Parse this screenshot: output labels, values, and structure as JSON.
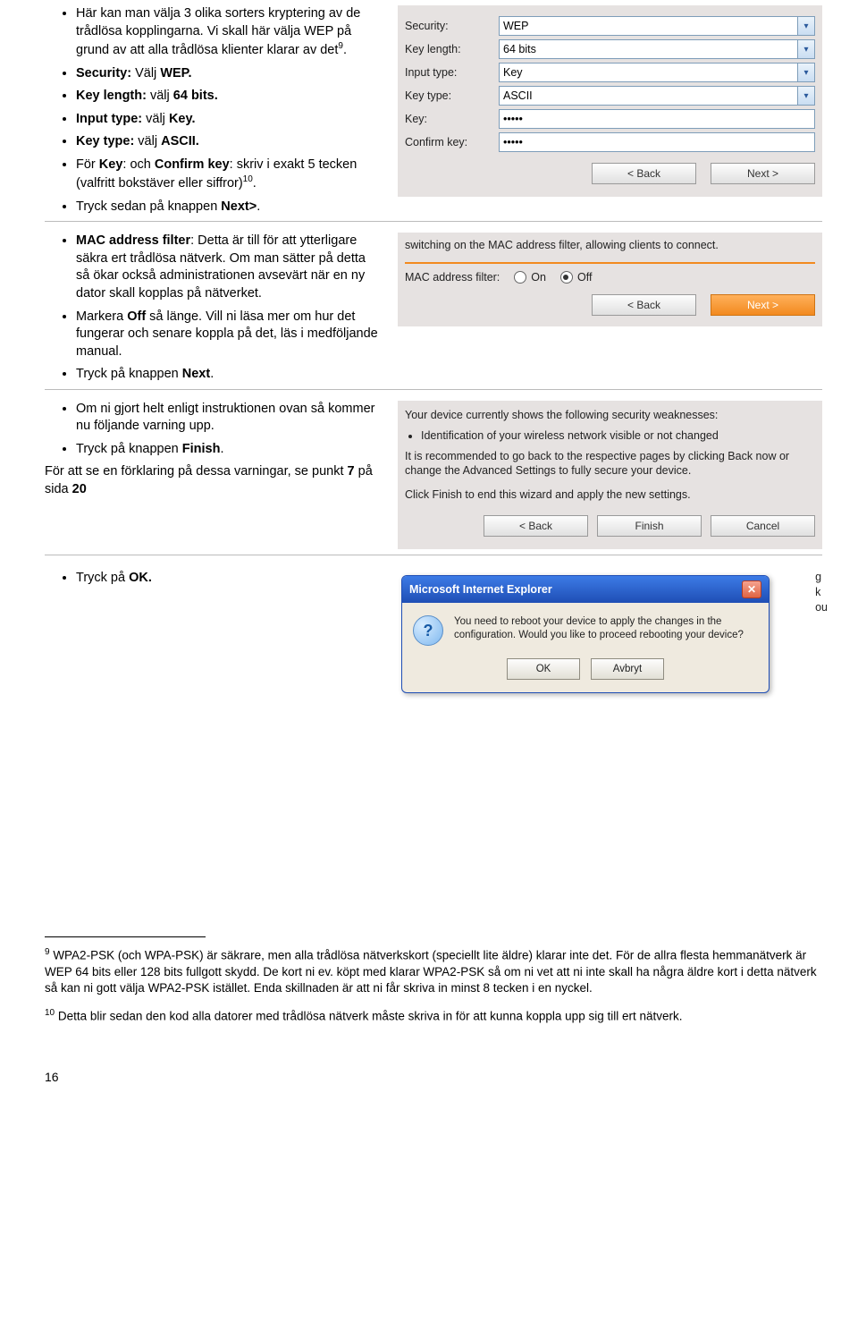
{
  "section1": {
    "bullets": [
      {
        "pre": "Här kan man välja 3 olika sorters kryptering av de trådlösa kopplingarna. Vi skall här välja WEP på grund av att alla trådlösa klienter klarar av det",
        "sup": "9",
        "post": "."
      },
      {
        "bold_parts": [
          "Security:",
          " Välj ",
          "WEP."
        ]
      },
      {
        "bold_parts": [
          "Key length:",
          " välj ",
          "64 bits."
        ]
      },
      {
        "bold_parts": [
          "Input type:",
          " välj ",
          "Key."
        ]
      },
      {
        "bold_parts": [
          "Key type:",
          " välj ",
          "ASCII."
        ]
      },
      {
        "text_a": "För ",
        "k": "Key",
        "text_b": ": och ",
        "ck": "Confirm key",
        "text_c": ": skriv i exakt 5 tecken (valfritt bokstäver eller siffror)",
        "sup": "10",
        "post": "."
      },
      {
        "text_a": "Tryck sedan på knappen ",
        "nb": "Next>",
        "post": "."
      }
    ],
    "form": {
      "security_label": "Security:",
      "security_value": "WEP",
      "keylen_label": "Key length:",
      "keylen_value": "64 bits",
      "input_label": "Input type:",
      "input_value": "Key",
      "keytype_label": "Key type:",
      "keytype_value": "ASCII",
      "key_label": "Key:",
      "key_value": "•••••",
      "confirm_label": "Confirm key:",
      "confirm_value": "•••••",
      "back": "< Back",
      "next": "Next >"
    }
  },
  "section2": {
    "bullets": [
      {
        "b": "MAC address filter",
        "text": ": Detta är till för att ytterligare säkra ert trådlösa nätverk. Om man sätter på detta så ökar också administrationen avsevärt när en ny dator skall kopplas på nätverket."
      },
      {
        "pre": "Markera ",
        "b": "Off",
        "text": " så länge. Vill ni läsa mer om hur det fungerar och senare koppla på det, läs i medföljande manual."
      },
      {
        "pre": "Tryck på knappen ",
        "b": "Next",
        "post": "."
      }
    ],
    "panel": {
      "line": "switching on the MAC address filter, allowing clients to connect.",
      "filter_label": "MAC address filter:",
      "on": "On",
      "off": "Off",
      "back": "< Back",
      "next": "Next >"
    }
  },
  "section3": {
    "bullets": [
      {
        "text": "Om ni gjort helt enligt instruktionen ovan så kommer nu följande varning upp."
      },
      {
        "pre": "Tryck på knappen ",
        "b": "Finish",
        "post": "."
      }
    ],
    "after_a": "För att se en förklaring på dessa varningar, se punkt ",
    "after_b": "7",
    "after_c": " på sida ",
    "after_d": "20",
    "panel": {
      "intro": "Your device currently shows the following security weaknesses:",
      "item": "Identification of your wireless network visible or not changed",
      "rec": "It is recommended to go back to the respective pages by clicking Back now or change the Advanced Settings to fully secure your device.",
      "fin": "Click Finish to end this wizard and apply the new settings.",
      "back": "< Back",
      "finish": "Finish",
      "cancel": "Cancel"
    }
  },
  "section4": {
    "bullet_pre": "Tryck på ",
    "bullet_b": "OK.",
    "dialog": {
      "title": "Microsoft Internet Explorer",
      "msg": "You need to reboot your device to apply the changes in the configuration. Would you like to proceed rebooting your device?",
      "ok": "OK",
      "cancel": "Avbryt"
    },
    "side_letters": "g\nk\nou"
  },
  "footnotes": {
    "f9_sup": "9",
    "f9": " WPA2-PSK (och WPA-PSK) är säkrare, men alla trådlösa nätverkskort (speciellt lite äldre) klarar inte det. För de allra flesta hemmanätverk är WEP 64 bits eller 128 bits fullgott skydd. De kort ni ev. köpt med klarar WPA2-PSK så om ni vet att ni inte skall ha några äldre kort i detta nätverk så kan ni gott välja WPA2-PSK istället. Enda skillnaden är att ni får skriva in minst 8 tecken i en nyckel.",
    "f10_sup": "10",
    "f10": " Detta blir sedan den kod alla datorer med trådlösa nätverk måste skriva in för att kunna koppla upp sig till ert nätverk."
  },
  "pagenum": "16"
}
